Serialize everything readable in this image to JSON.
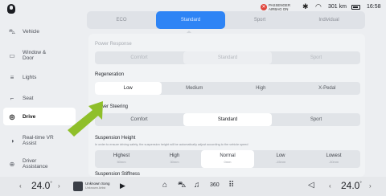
{
  "status": {
    "airbag": "PASSENGER AIRBAG ON",
    "airbag_line1": "PASSENGER",
    "airbag_line2": "AIRBAG ON",
    "range": "301 km",
    "time": "16:58"
  },
  "sidebar": {
    "items": [
      {
        "label": "Vehicle",
        "icon": "car-icon"
      },
      {
        "label": "Window & Door",
        "line1": "Window &",
        "line2": "Door",
        "icon": "window-icon"
      },
      {
        "label": "Lights",
        "icon": "lights-icon"
      },
      {
        "label": "Seat",
        "icon": "seat-icon"
      },
      {
        "label": "Drive",
        "icon": "steering-wheel-icon"
      },
      {
        "label": "Real-time VR Assist",
        "line1": "Real-time VR",
        "line2": "Assist",
        "icon": "vr-icon"
      },
      {
        "label": "Driver Assistance",
        "line1": "Driver",
        "line2": "Assistance",
        "icon": "driver-assist-icon"
      }
    ],
    "active": "Drive"
  },
  "drive_modes": {
    "tabs": [
      "ECO",
      "Standard",
      "Sport",
      "Individual"
    ],
    "selected": "Standard"
  },
  "power_response": {
    "title": "Power Response",
    "options": [
      "Comfort",
      "Standard",
      "Sport"
    ],
    "selected": "Standard"
  },
  "regeneration": {
    "title": "Regeneration",
    "options": [
      "Low",
      "Medium",
      "High",
      "X-Pedal"
    ],
    "selected": "Low"
  },
  "power_steering": {
    "title": "Power Steering",
    "options": [
      "Comfort",
      "Standard",
      "Sport"
    ],
    "selected": "Standard"
  },
  "suspension_height": {
    "title": "Suspension Height",
    "note": "In order to ensure driving safety, the suspension height will be automatically adjust according to the vehicle speed",
    "options": [
      {
        "label": "Highest",
        "value": "50mm"
      },
      {
        "label": "High",
        "value": "30mm"
      },
      {
        "label": "Normal",
        "value": "0mm"
      },
      {
        "label": "Low",
        "value": "-15mm"
      },
      {
        "label": "Lowest",
        "value": "-30mm"
      }
    ],
    "selected": "Normal"
  },
  "suspension_stiffness": {
    "title": "Suspension Stiffness"
  },
  "dock": {
    "left_temp": "24.0",
    "right_temp": "24.0",
    "temp_unit": "°",
    "song": "Unknown Song",
    "artist": "Unknown Artist"
  },
  "colors": {
    "accent": "#2e84f5",
    "highlight_arrow": "#8fbf2a"
  }
}
